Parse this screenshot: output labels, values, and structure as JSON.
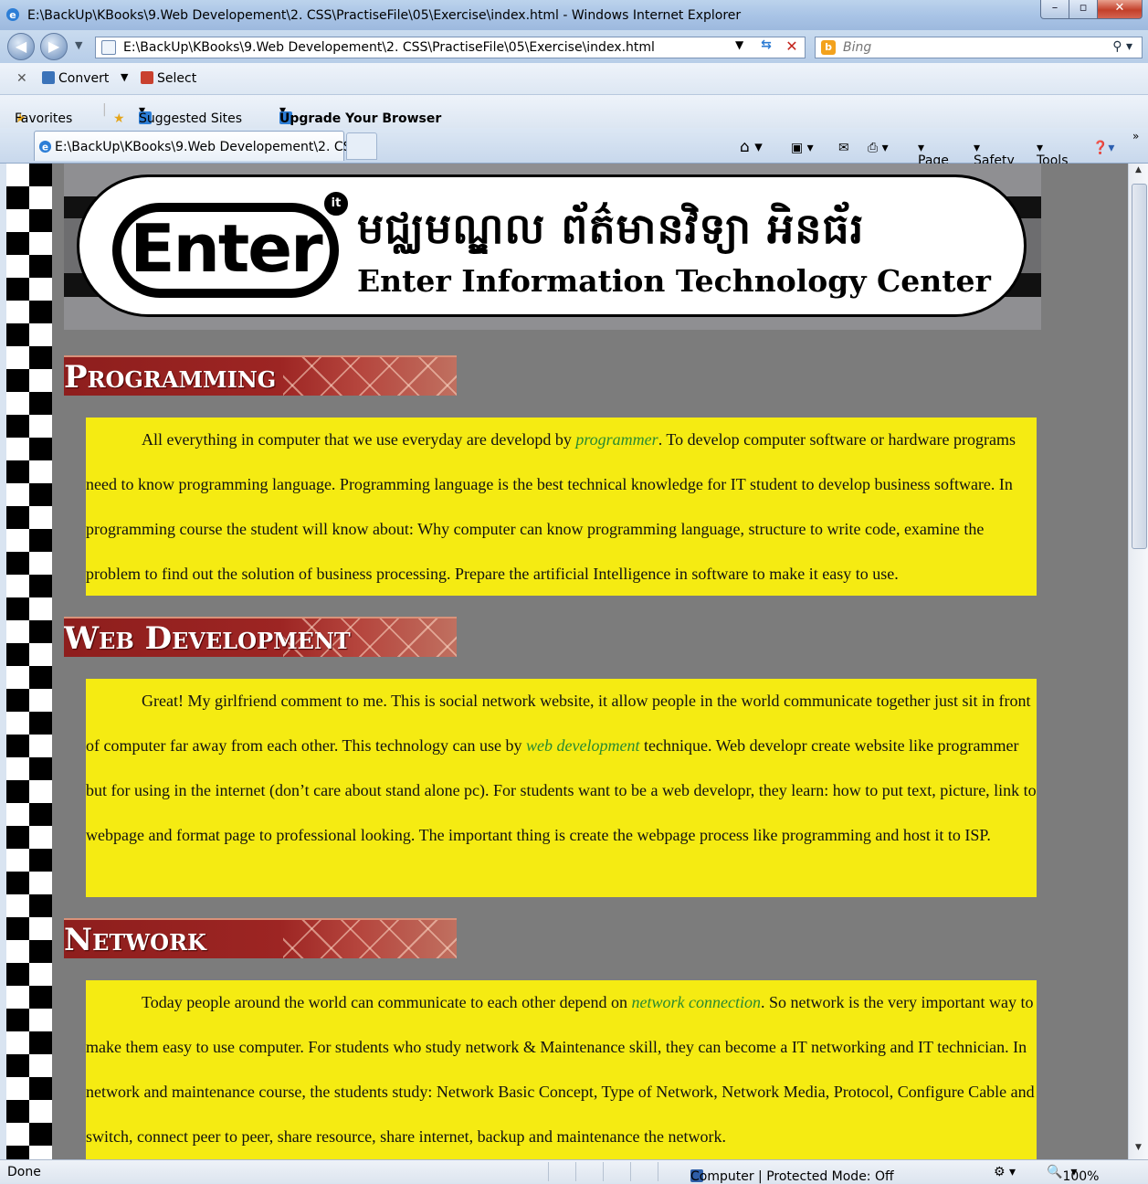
{
  "window": {
    "title": "E:\\BackUp\\KBooks\\9.Web Developement\\2. CSS\\PractiseFile\\05\\Exercise\\index.html - Windows Internet Explorer"
  },
  "address": {
    "url": "E:\\BackUp\\KBooks\\9.Web Developement\\2. CSS\\PractiseFile\\05\\Exercise\\index.html",
    "search_placeholder": "Bing"
  },
  "command_bar": {
    "convert_label": "Convert",
    "select_label": "Select"
  },
  "favorites_bar": {
    "favorites_label": "Favorites",
    "suggested_label": "Suggested Sites",
    "upgrade_label": "Upgrade Your Browser"
  },
  "tab": {
    "title": "E:\\BackUp\\KBooks\\9.Web Developement\\2. CSS\\..."
  },
  "toolbar": {
    "page_label": "Page",
    "safety_label": "Safety",
    "tools_label": "Tools"
  },
  "banner": {
    "logo_text": "Enter",
    "khmer_name": "មជ្ឈមណ្ឌល ព័ត៌មានវិទ្យា អិនធ័រ",
    "english_name": "Enter Information Technology Center"
  },
  "sections": [
    {
      "heading": "Programming",
      "before": "All everything in computer that we use everyday are developd by ",
      "link": "programmer",
      "after": ". To develop computer software or hardware programs need to know programming language. Programming language is the best technical knowledge for IT student to develop business software. In programming course the student will know about: Why computer can know programming language, structure to write code, examine the problem to find out the solution of business processing. Prepare the artificial Intelligence in software to make it easy to use."
    },
    {
      "heading": "Web Development",
      "before": "Great! My girlfriend comment to me. This is social network website, it allow people in the world communicate together just sit in front of computer far away from each other. This technology can use by ",
      "link": "web development",
      "after": " technique. Web developr create website like programmer but for using in the internet (don’t care about stand alone pc). For students want to be a web developr, they learn: how to put text, picture, link to webpage and format page to professional looking. The important thing is create the webpage process like programming and host it to ISP."
    },
    {
      "heading": "Network",
      "before": "Today people around the world can communicate to each other depend on ",
      "link": "network connection",
      "after": ". So network is the very important way to make them easy to use computer. For students who study network & Maintenance skill, they can become a IT networking and IT technician. In network and maintenance course, the students study: Network Basic Concept, Type of Network, Network Media, Protocol, Configure Cable and switch, connect peer to peer, share resource, share internet, backup and maintenance the network."
    }
  ],
  "status_bar": {
    "status_text": "Done",
    "zone_text": "Computer | Protected Mode: Off",
    "zoom_text": "100%"
  },
  "colors": {
    "page_background": "#7c7c7c",
    "content_box": "#f5eb12",
    "heading_bar": "#9d2523",
    "link": "#2a8a30"
  }
}
